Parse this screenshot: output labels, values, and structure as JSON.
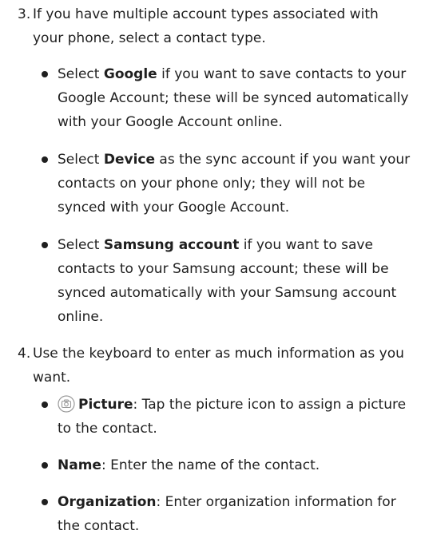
{
  "step3": {
    "number": "3.",
    "text": "If you have multiple account types associated with your phone, select a contact type.",
    "bullets": [
      {
        "pre": "Select ",
        "bold": "Google",
        "post": " if you want to save contacts to your Google Account; these will be synced automatically with your Google Account online."
      },
      {
        "pre": "Select ",
        "bold": "Device",
        "post": " as the sync account if you want your contacts on your phone only; they will not be synced with your Google Account."
      },
      {
        "pre": "Select ",
        "bold": "Samsung account",
        "post": " if you want to save contacts to your Samsung account; these will be synced automatically with your Samsung account online."
      }
    ]
  },
  "step4": {
    "number": "4.",
    "text": "Use the keyboard to enter as much information as you want.",
    "bullets": [
      {
        "icon": "camera-icon",
        "bold": "Picture",
        "post": ": Tap the picture icon to assign a picture to the contact."
      },
      {
        "bold": "Name",
        "post": ": Enter the name of the contact."
      },
      {
        "bold": "Organization",
        "post": ": Enter organization information for the contact."
      }
    ]
  }
}
